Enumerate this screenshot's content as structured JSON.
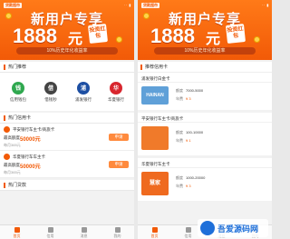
{
  "banner": {
    "status_logo": "贷款超市",
    "status_right": "·· ▮",
    "title": "新用户专享",
    "amount": "1888",
    "unit": "元",
    "badge": "投资红包",
    "subtitle": "10%历史年化收益率"
  },
  "left": {
    "section_hot": "热门推荐",
    "banks": [
      {
        "name": "信用钱包",
        "logo": "钱",
        "color": "#2fa84f"
      },
      {
        "name": "借钱秒",
        "logo": "借",
        "color": "#444444"
      },
      {
        "name": "浦发银行",
        "logo": "浦",
        "color": "#1d4fa3"
      },
      {
        "name": "华夏银行",
        "logo": "华",
        "color": "#d8262e"
      }
    ],
    "section_card": "热门信用卡",
    "loans": [
      {
        "title": "平安银行车主卡/商旅卡",
        "label": "最高额度",
        "amount": "50000元",
        "sub": "每月365元",
        "button": "申请"
      },
      {
        "title": "华夏银行车车主卡",
        "label": "最高额度",
        "amount": "50000元",
        "sub": "每月365元",
        "button": "申请"
      }
    ],
    "section_more": "热门贷款"
  },
  "right": {
    "section_title": "推荐信用卡",
    "cards": [
      {
        "name": "浦发银行白金卡",
        "row1_label": "额度",
        "row1_value": "7000-5000",
        "row2_label": "年费",
        "row2_value": "¥ 3",
        "thumb_color": "#5fa0d8",
        "thumb_text": "HAINAN"
      },
      {
        "name": "平安银行车主卡/商旅卡",
        "row1_label": "额度",
        "row1_value": "100-10000",
        "row2_label": "年费",
        "row2_value": "¥ 1",
        "thumb_color": "#f07a2a",
        "thumb_text": ""
      },
      {
        "name": "华夏银行车主卡",
        "row1_label": "额度",
        "row1_value": "1000-20000",
        "row2_label": "年费",
        "row2_value": "¥ 3",
        "thumb_color": "#ef6a1f",
        "thumb_text": "慧家"
      }
    ]
  },
  "tabs": [
    {
      "label": "首页",
      "active": true
    },
    {
      "label": "信用",
      "active": false
    },
    {
      "label": "消息",
      "active": false
    },
    {
      "label": "我的",
      "active": false
    }
  ],
  "watermark": {
    "text": "吾爱源码网"
  }
}
